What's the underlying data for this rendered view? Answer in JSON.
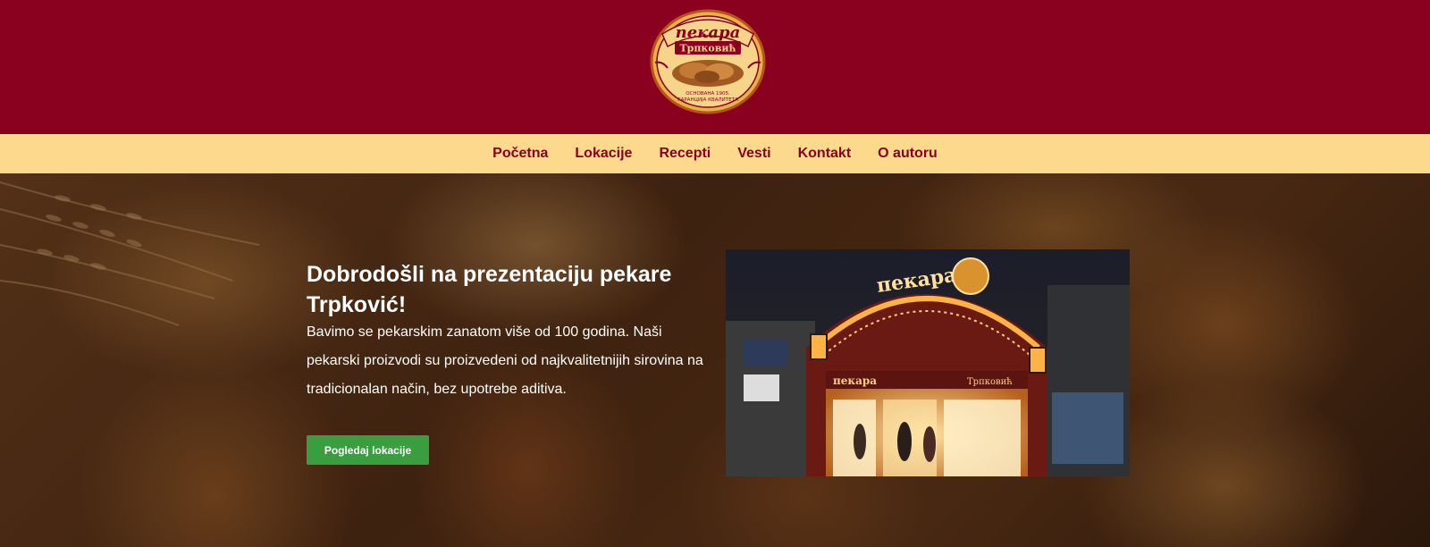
{
  "logo": {
    "top_text": "пекара",
    "name_text": "Трпковић",
    "bottom_line1": "ОСНОВАНА 1905.",
    "bottom_line2": "ГАРАНЦИЈА КВАЛИТЕТА"
  },
  "nav": {
    "items": [
      {
        "label": "Početna"
      },
      {
        "label": "Lokacije"
      },
      {
        "label": "Recepti"
      },
      {
        "label": "Vesti"
      },
      {
        "label": "Kontakt"
      },
      {
        "label": "O autoru"
      }
    ]
  },
  "hero": {
    "title": "Dobrodošli na prezentaciju pekare Trpković!",
    "text": "Bavimo se pekarskim zanatom više od 100 godina. Naši pekarski proizvodi su proizvedeni od najkvalitetnijih sirovina na tradicionalan način, bez upotrebe aditiva.",
    "button_label": "Pogledaj lokacije"
  },
  "photo": {
    "sign_text": "пекара",
    "shop_sign": "пекара",
    "shop_sign_name": "Трпковић"
  },
  "colors": {
    "header_bg": "#8a001f",
    "nav_bg": "#fcd98c",
    "nav_text": "#8a001f",
    "button_bg": "#3a9d3f"
  }
}
